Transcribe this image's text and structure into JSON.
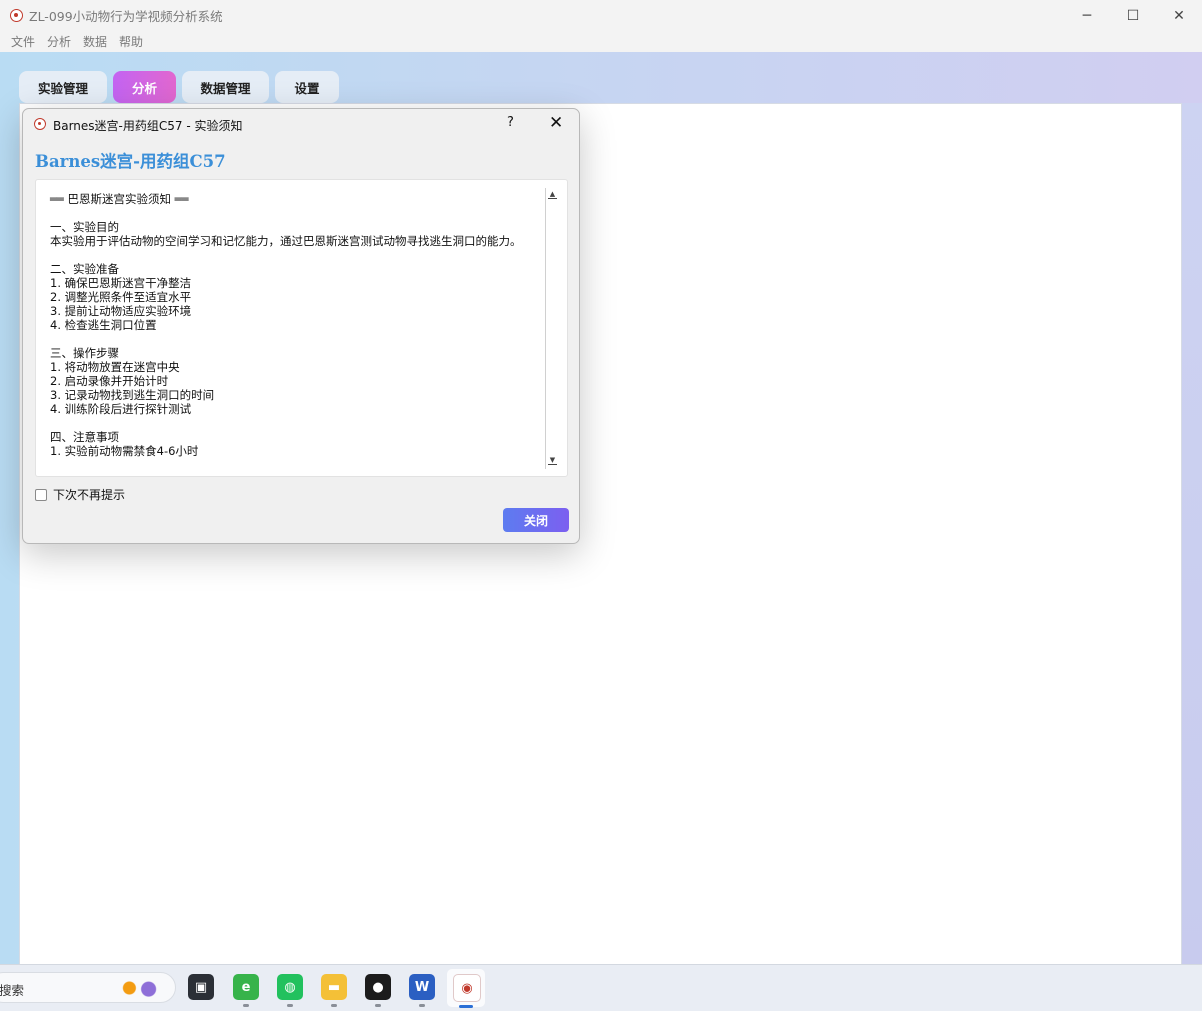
{
  "window": {
    "title": "ZL-099小动物行为学视频分析系统",
    "minimize": "─",
    "maximize": "☐",
    "close": "✕"
  },
  "menu": [
    "文件",
    "分析",
    "数据",
    "帮助"
  ],
  "tabs": [
    {
      "label": "实验管理",
      "active": false
    },
    {
      "label": "分析",
      "active": true
    },
    {
      "label": "数据管理",
      "active": false
    },
    {
      "label": "设置",
      "active": false
    }
  ],
  "dialog": {
    "title": "Barnes迷宫-用药组C57 - 实验须知",
    "help": "?",
    "close": "✕",
    "heading": "Barnes迷宫-用药组C57",
    "notice_lines": [
      "══ 巴恩斯迷宫实验须知 ══",
      "",
      "一、实验目的",
      "本实验用于评估动物的空间学习和记忆能力，通过巴恩斯迷宫测试动物寻找逃生洞口的能力。",
      "",
      "二、实验准备",
      "1. 确保巴恩斯迷宫干净整洁",
      "2. 调整光照条件至适宜水平",
      "3. 提前让动物适应实验环境",
      "4. 检查逃生洞口位置",
      "",
      "三、操作步骤",
      "1. 将动物放置在迷宫中央",
      "2. 启动录像并开始计时",
      "3. 记录动物找到逃生洞口的时间",
      "4. 训练阶段后进行探针测试",
      "",
      "四、注意事项",
      "1. 实验前动物需禁食4-6小时"
    ],
    "scroll_up": "▲",
    "scroll_down": "▼",
    "dont_show_again": "下次不再提示",
    "dont_show_checked": false,
    "close_button": "关闭"
  },
  "taskbar": {
    "search_placeholder": "搜索",
    "apps": [
      {
        "name": "task-view",
        "glyph": "▣"
      },
      {
        "name": "ie-browser",
        "glyph": "e"
      },
      {
        "name": "wechat",
        "glyph": "◍"
      },
      {
        "name": "file-explorer",
        "glyph": "▬"
      },
      {
        "name": "qq",
        "glyph": "●"
      },
      {
        "name": "word",
        "glyph": "W"
      },
      {
        "name": "zl-analysis-app",
        "glyph": "◉"
      }
    ]
  },
  "colors": {
    "accent_tab": "#d066e6",
    "heading_blue": "#3b8fd8",
    "close_button": "#6a6ef0"
  }
}
